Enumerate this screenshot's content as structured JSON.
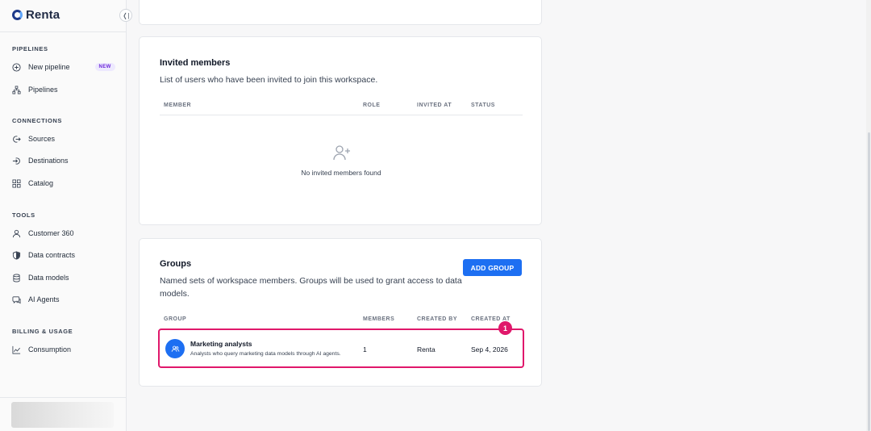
{
  "app": {
    "logo_text": "Renta",
    "brand_color": "#1d6ff2",
    "highlight_color": "#e0186b"
  },
  "sidebar": {
    "collapse_icon": "collapse-left-icon",
    "sections": {
      "pipelines": "PIPELINES",
      "connections": "CONNECTIONS",
      "tools": "TOOLS",
      "billing": "BILLING & USAGE"
    },
    "items": {
      "new_pipeline": {
        "label": "New pipeline",
        "badge": "NEW",
        "icon": "plus-circle-icon"
      },
      "pipelines": {
        "label": "Pipelines",
        "icon": "hierarchy-icon"
      },
      "sources": {
        "label": "Sources",
        "icon": "source-arrow-icon"
      },
      "destinations": {
        "label": "Destinations",
        "icon": "destination-arrow-icon"
      },
      "catalog": {
        "label": "Catalog",
        "icon": "grid-icon"
      },
      "customer360": {
        "label": "Customer 360",
        "icon": "user-icon"
      },
      "data_contracts": {
        "label": "Data contracts",
        "icon": "shield-icon"
      },
      "data_models": {
        "label": "Data models",
        "icon": "database-icon"
      },
      "ai_agents": {
        "label": "AI Agents",
        "icon": "chat-icon"
      },
      "consumption": {
        "label": "Consumption",
        "icon": "chart-line-icon"
      }
    }
  },
  "invited": {
    "title": "Invited members",
    "description": "List of users who have been invited to join this workspace.",
    "columns": {
      "member": "MEMBER",
      "role": "ROLE",
      "invited_at": "INVITED AT",
      "status": "STATUS"
    },
    "empty_icon": "user-plus-icon",
    "empty_text": "No invited members found"
  },
  "groups": {
    "title": "Groups",
    "description_line1": "Named sets of workspace members. Groups will be used to grant access to data",
    "description_line2": "models.",
    "add_button": "ADD GROUP",
    "columns": {
      "group": "GROUP",
      "members": "MEMBERS",
      "created_by": "CREATED BY",
      "created_at": "CREATED AT"
    },
    "rows": [
      {
        "name": "Marketing analysts",
        "description": "Analysts who query marketing data models through AI agents.",
        "members": "1",
        "created_by": "Renta",
        "created_at": "Sep 4, 2026",
        "icon": "group-users-icon"
      }
    ],
    "marker": "1"
  }
}
